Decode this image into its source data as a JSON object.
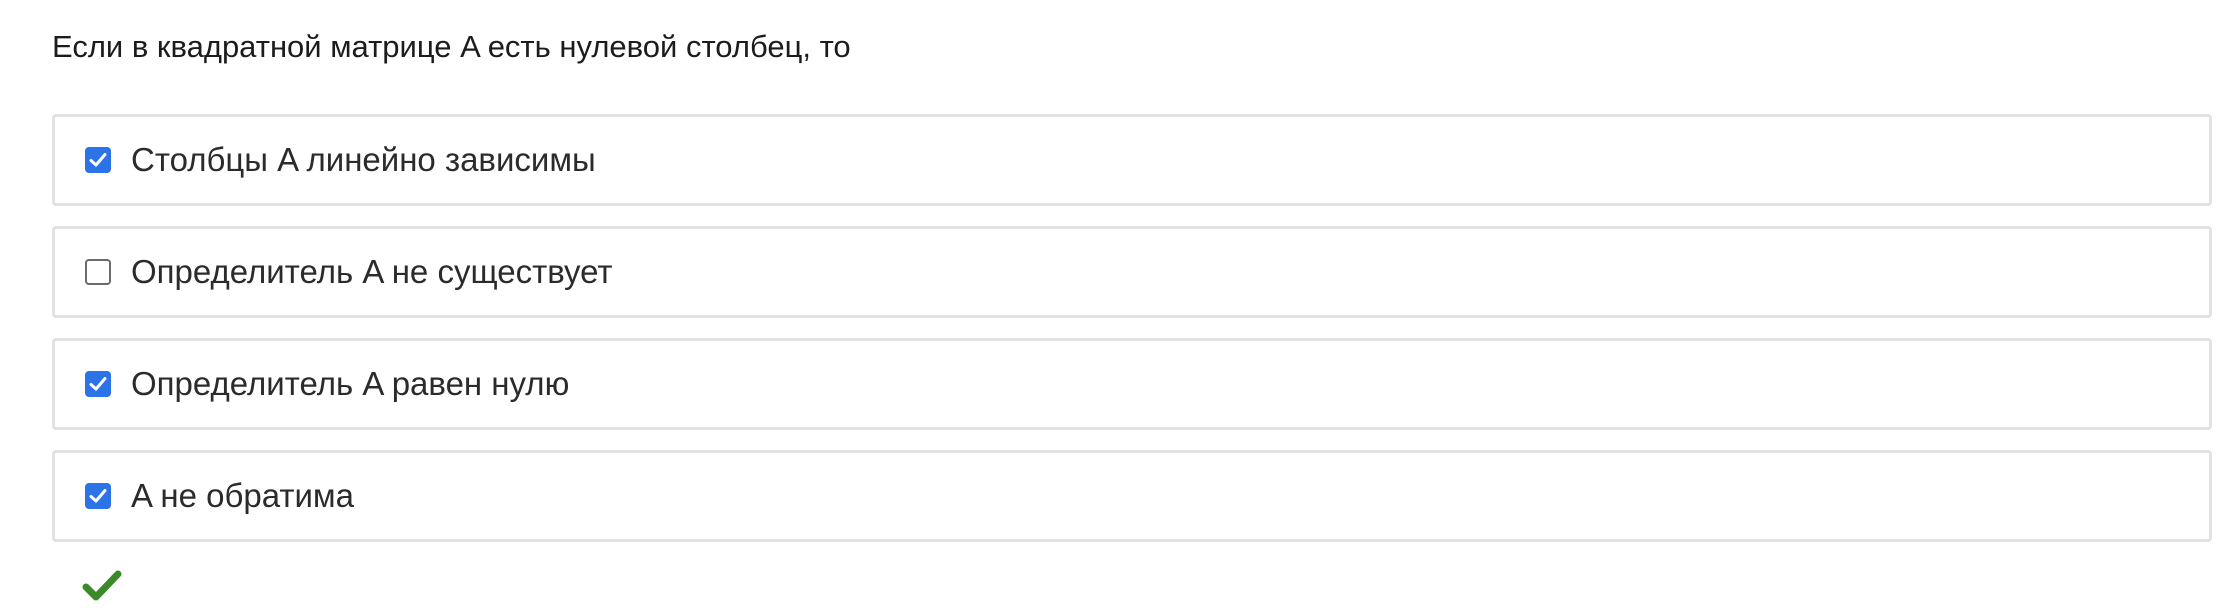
{
  "question": {
    "text": "Если в квадратной матрице A есть нулевой столбец, то"
  },
  "options": [
    {
      "label": "Столбцы A линейно зависимы",
      "checked": true
    },
    {
      "label": "Определитель A не существует",
      "checked": false
    },
    {
      "label": "Определитель A равен нулю",
      "checked": true
    },
    {
      "label": "A не обратима",
      "checked": true
    }
  ],
  "result": {
    "icon": "check-mark-icon",
    "color": "#3a8a2a"
  },
  "colors": {
    "checkbox_checked": "#2b73e6",
    "option_border": "#e2e2e2"
  }
}
